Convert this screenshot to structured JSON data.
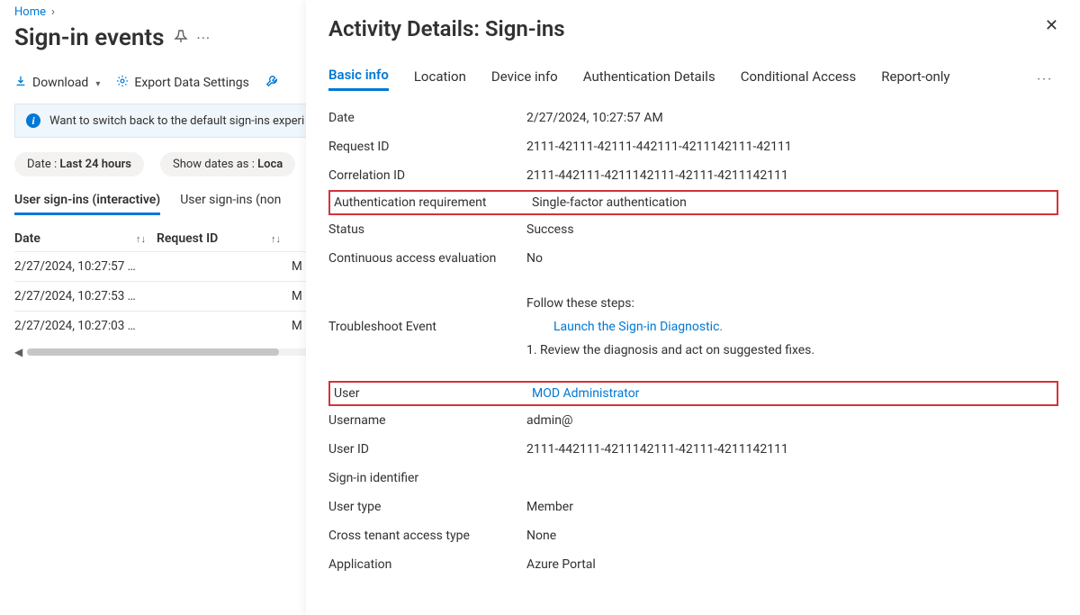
{
  "breadcrumb": {
    "home": "Home"
  },
  "page": {
    "title": "Sign-in events"
  },
  "toolbar": {
    "download": "Download",
    "export_settings": "Export Data Settings"
  },
  "banner": {
    "text": "Want to switch back to the default sign-ins experi"
  },
  "pills": {
    "date_label": "Date :",
    "date_value": "Last 24 hours",
    "showdates_label": "Show dates as :",
    "showdates_value": "Loca"
  },
  "subtabs": {
    "interactive": "User sign-ins (interactive)",
    "noninteractive": "User sign-ins (non"
  },
  "grid": {
    "headers": {
      "date": "Date",
      "request_id": "Request ID"
    },
    "rows": [
      {
        "date": "2/27/2024, 10:27:57 …",
        "extra": "M"
      },
      {
        "date": "2/27/2024, 10:27:53 …",
        "extra": "M"
      },
      {
        "date": "2/27/2024, 10:27:03 …",
        "extra": "M"
      }
    ]
  },
  "panel": {
    "title": "Activity Details: Sign-ins",
    "tabs": {
      "basic": "Basic info",
      "location": "Location",
      "device": "Device info",
      "auth": "Authentication Details",
      "ca": "Conditional Access",
      "report": "Report-only"
    },
    "fields": {
      "date_k": "Date",
      "date_v": "2/27/2024, 10:27:57 AM",
      "reqid_k": "Request ID",
      "reqid_v": "2111-42111-42111-442111-4211142111-42111",
      "corrid_k": "Correlation ID",
      "corrid_v": "2111-442111-4211142111-42111-4211142111",
      "authreq_k": "Authentication requirement",
      "authreq_v": "Single-factor authentication",
      "status_k": "Status",
      "status_v": "Success",
      "cae_k": "Continuous access evaluation",
      "cae_v": "No",
      "trouble_k": "Troubleshoot Event",
      "trouble_follow": "Follow these steps:",
      "trouble_launch": "Launch the Sign-in Diagnostic.",
      "trouble_review": "1. Review the diagnosis and act on suggested fixes.",
      "user_k": "User",
      "user_v": "MOD Administrator",
      "username_k": "Username",
      "username_v": "admin@",
      "userid_k": "User ID",
      "userid_v": "2111-442111-4211142111-42111-4211142111",
      "signinid_k": "Sign-in identifier",
      "signinid_v": "",
      "usertype_k": "User type",
      "usertype_v": "Member",
      "ctat_k": "Cross tenant access type",
      "ctat_v": "None",
      "app_k": "Application",
      "app_v": "Azure Portal"
    }
  }
}
